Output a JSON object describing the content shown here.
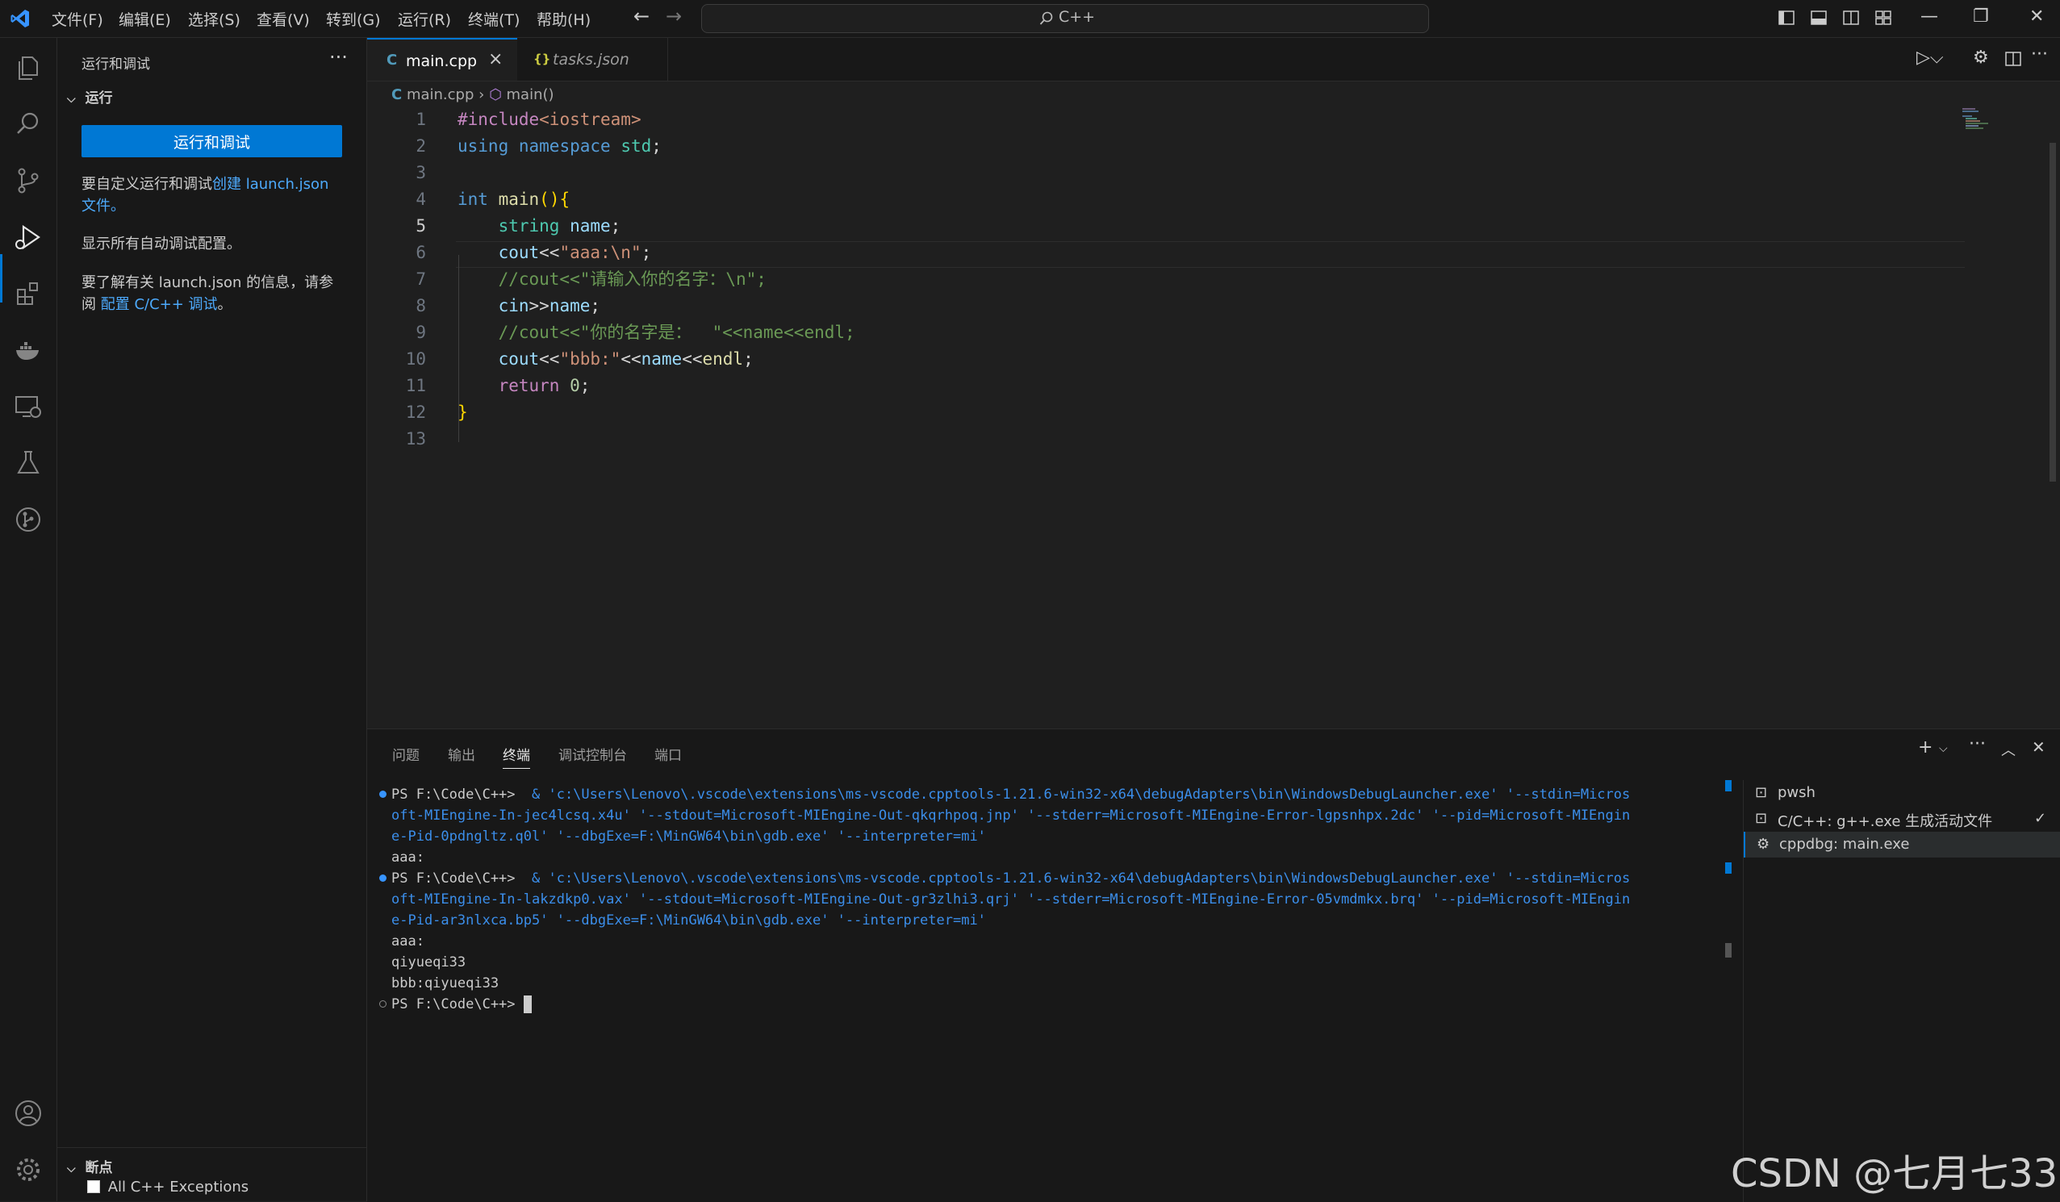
{
  "titlebar": {
    "menus": [
      "文件(F)",
      "编辑(E)",
      "选择(S)",
      "查看(V)",
      "转到(G)",
      "运行(R)",
      "终端(T)",
      "帮助(H)"
    ],
    "search_text": "C++"
  },
  "sidebar": {
    "title": "运行和调试",
    "run_section": "运行",
    "run_button": "运行和调试",
    "custom_text": "要自定义运行和调试",
    "create_link": "创建 launch.json",
    "file_text": "文件。",
    "show_all_link": "显示所有自动调试配置。",
    "learn_text": "要了解有关 launch.json 的信息，请参阅",
    "config_link": "配置 C/C++ 调试",
    "period": "。",
    "breakpoints_section": "断点",
    "breakpoint_item": "All C++ Exceptions"
  },
  "editor": {
    "tabs": [
      {
        "label": "main.cpp",
        "icon": "C"
      },
      {
        "label": "tasks.json",
        "icon": "{}"
      }
    ],
    "breadcrumb": {
      "file": "main.cpp",
      "symbol": "main()"
    },
    "line_numbers": [
      "1",
      "2",
      "3",
      "4",
      "5",
      "6",
      "7",
      "8",
      "9",
      "10",
      "11",
      "12",
      "13"
    ],
    "current_line": "5"
  },
  "panel": {
    "tabs": [
      "问题",
      "输出",
      "终端",
      "调试控制台",
      "端口"
    ],
    "active_tab": "终端",
    "terminal_lines": [
      {
        "prompt": "PS F:\\Code\\C++> ",
        "cmd": " & 'c:\\Users\\Lenovo\\.vscode\\extensions\\ms-vscode.cpptools-1.21.6-win32-x64\\debugAdapters\\bin\\WindowsDebugLauncher.exe' '--stdin=Micros",
        "dot": "#3794ff"
      },
      {
        "text": "oft-MIEngine-In-jec4lcsq.x4u' '--stdout=Microsoft-MIEngine-Out-qkqrhpoq.jnp' '--stderr=Microsoft-MIEngine-Error-lgpsnhpx.2dc' '--pid=Microsoft-MIEngin",
        "cmd": true
      },
      {
        "text": "e-Pid-0pdngltz.q0l' '--dbgExe=F:\\MinGW64\\bin\\gdb.exe' '--interpreter=mi'",
        "cmd": true
      },
      {
        "text": "aaa:"
      },
      {
        "prompt": "PS F:\\Code\\C++> ",
        "cmd": " & 'c:\\Users\\Lenovo\\.vscode\\extensions\\ms-vscode.cpptools-1.21.6-win32-x64\\debugAdapters\\bin\\WindowsDebugLauncher.exe' '--stdin=Micros",
        "dot": "#3794ff"
      },
      {
        "text": "oft-MIEngine-In-lakzdkp0.vax' '--stdout=Microsoft-MIEngine-Out-gr3zlhi3.qrj' '--stderr=Microsoft-MIEngine-Error-05vmdmkx.brq' '--pid=Microsoft-MIEngin",
        "cmd": true
      },
      {
        "text": "e-Pid-ar3nlxca.bp5' '--dbgExe=F:\\MinGW64\\bin\\gdb.exe' '--interpreter=mi'",
        "cmd": true
      },
      {
        "text": "aaa:"
      },
      {
        "text": "qiyueqi33"
      },
      {
        "text": "bbb:qiyueqi33"
      },
      {
        "prompt": "PS F:\\Code\\C++> ",
        "cursor": true,
        "dot": "hollow"
      }
    ],
    "terminals": [
      {
        "label": "pwsh",
        "icon": "terminal-icon"
      },
      {
        "label": "C/C++: g++.exe 生成活动文件",
        "icon": "terminal-icon",
        "check": "✓"
      },
      {
        "label": "cppdbg: main.exe",
        "icon": "debug-gear-icon",
        "selected": true
      }
    ]
  },
  "watermark": "CSDN @七月七33",
  "colors": {
    "accent": "#0078d4",
    "link": "#4daafc",
    "background": "#1f1f1f",
    "sidebar": "#181818"
  }
}
